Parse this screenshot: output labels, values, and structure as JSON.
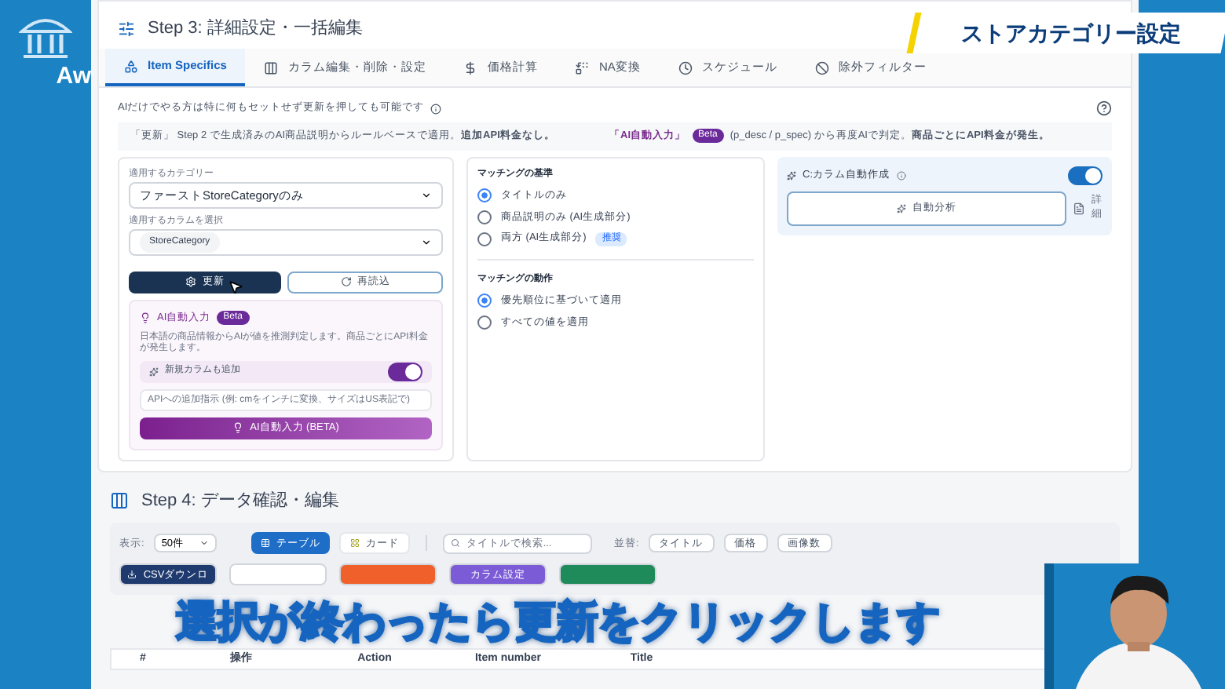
{
  "logo": {
    "text": "Aw"
  },
  "banner": {
    "text": "ストアカテゴリー設定"
  },
  "step3": {
    "title": "Step 3: 詳細設定・一括編集",
    "tabs": [
      {
        "label": "Item Specifics",
        "selected": true
      },
      {
        "label": "カラム編集・削除・設定",
        "selected": false
      },
      {
        "label": "価格計算",
        "selected": false
      },
      {
        "label": "NA変換",
        "selected": false
      },
      {
        "label": "スケジュール",
        "selected": false
      },
      {
        "label": "除外フィルター",
        "selected": false
      }
    ],
    "hint": "AIだけでやる方は特に何もセットせず更新を押しても可能です",
    "info_left": "「更新」 Step 2 で生成済みのAI商品説明からルールベースで適用。**追加API料金なし。**",
    "info_right_label": "「AI自動入力」",
    "info_right_badge": "Beta",
    "info_right": "(p_desc / p_spec) から再度AIで判定。**商品ごとにAPI料金が発生。**",
    "category_field": {
      "label": "適用するカテゴリー",
      "value": "ファーストStoreCategoryのみ"
    },
    "column_field": {
      "label": "適用するカラムを選択",
      "chip": "StoreCategory"
    },
    "update_button": "更新",
    "reload_button": "再読込",
    "ai_box": {
      "title": "AI自動入力",
      "badge": "Beta",
      "description": "日本語の商品情報からAIが値を推測判定します。商品ごとにAPI料金が発生します。",
      "toggle_label": "新規カラムも追加",
      "toggle_on": true,
      "placeholder": "APIへの追加指示 (例: cmをインチに変換、サイズはUS表記で)",
      "button": "AI自動入力 (BETA)"
    },
    "matching_basis": {
      "title": "マッチングの基準",
      "options": [
        {
          "label": "タイトルのみ",
          "selected": true
        },
        {
          "label": "商品説明のみ (AI生成部分)",
          "selected": false
        },
        {
          "label": "両方 (AI生成部分)",
          "selected": false,
          "badge": "推奨"
        }
      ]
    },
    "matching_action": {
      "title": "マッチングの動作",
      "options": [
        {
          "label": "優先順位に基づいて適用",
          "selected": true
        },
        {
          "label": "すべての値を適用",
          "selected": false
        }
      ]
    },
    "auto_column": {
      "title": "C:カラム自動作成",
      "on": true,
      "button": "自動分析",
      "detail": "詳細"
    }
  },
  "step4": {
    "title": "Step 4: データ確認・編集",
    "display_label": "表示:",
    "page_size": "50件",
    "views": [
      {
        "label": "テーブル",
        "selected": true
      },
      {
        "label": "カード",
        "selected": false
      }
    ],
    "search": {
      "placeholder": "タイトルで検索..."
    },
    "sort_label": "並替:",
    "sorts": [
      "タイトル",
      "価格",
      "画像数"
    ],
    "actions": [
      {
        "label": "CSVダウンロ",
        "color": "#1e3a6e"
      },
      {
        "color": "#ffffff"
      },
      {
        "color": "#f0602a"
      },
      {
        "label": "カラム設定",
        "color": "#7b5cd6"
      },
      {
        "color": "#1f8a5a"
      }
    ],
    "columns": [
      "#",
      "操作",
      "Action",
      "Item number",
      "Title"
    ]
  },
  "subtitle": "選択が終わったら更新をクリックします"
}
